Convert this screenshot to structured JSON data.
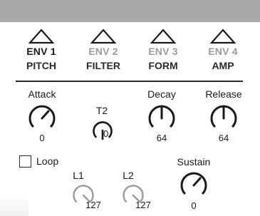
{
  "tabs": [
    {
      "name": "ENV 1",
      "dest": "PITCH",
      "active": true
    },
    {
      "name": "ENV 2",
      "dest": "FILTER",
      "active": false
    },
    {
      "name": "ENV 3",
      "dest": "FORM",
      "active": false
    },
    {
      "name": "ENV 4",
      "dest": "AMP",
      "active": false
    }
  ],
  "controls": {
    "attack": {
      "label": "Attack",
      "value": "0"
    },
    "t2": {
      "label": "T2",
      "value": "0"
    },
    "decay": {
      "label": "Decay",
      "value": "64"
    },
    "release": {
      "label": "Release",
      "value": "64"
    },
    "l1": {
      "label": "L1",
      "value": "127"
    },
    "l2": {
      "label": "L2",
      "value": "127"
    },
    "sustain": {
      "label": "Sustain",
      "value": "0"
    }
  },
  "loop": {
    "label": "Loop",
    "checked": false
  },
  "colors": {
    "top_strip": "#a9a9a9",
    "active_text": "#1a1a1a",
    "inactive_text": "#9c9c9c",
    "disabled_knob": "#9a9a9a"
  },
  "icons": {
    "tab_arrow": "triangle-up-icon"
  }
}
